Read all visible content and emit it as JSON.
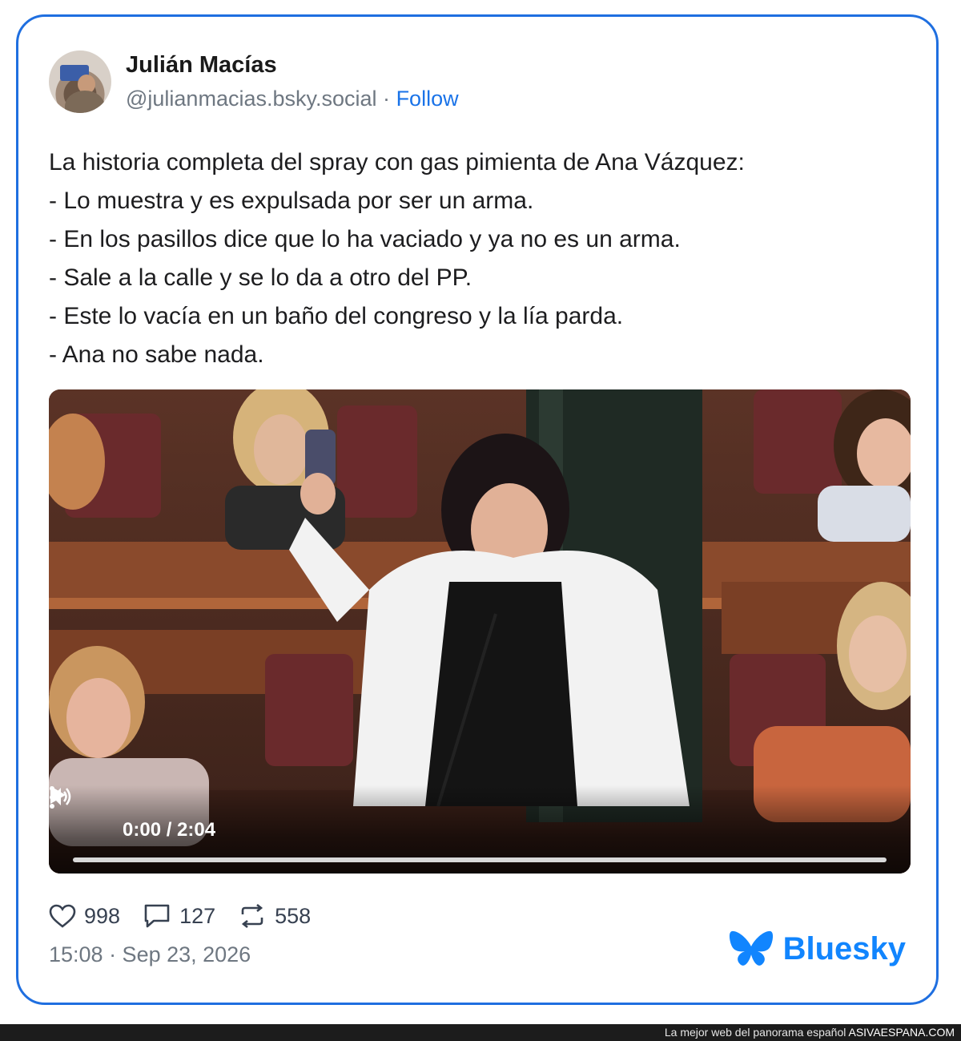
{
  "post": {
    "author_name": "Julián Macías",
    "handle": "@julianmacias.bsky.social",
    "separator": "·",
    "follow_label": "Follow",
    "text_lines": [
      "La historia completa del spray con gas pimienta de Ana Vázquez:",
      "- Lo muestra y es expulsada por ser un arma.",
      "- En los pasillos dice que lo ha vaciado y ya no es un arma.",
      "- Sale a la calle y se lo da a otro del PP.",
      "- Este lo vacía en un baño del congreso y la lía parda.",
      "- Ana no sabe nada."
    ],
    "video": {
      "time_label": "0:00 / 2:04",
      "progress": 0,
      "play_icon": "play-icon",
      "volume_icon": "volume-icon",
      "more_icon": "more-vertical-icon"
    },
    "stats": {
      "likes": "998",
      "replies": "127",
      "reposts": "558"
    },
    "timestamp": "15:08 · Sep 23, 2026",
    "brand_label": "Bluesky"
  },
  "footer": {
    "tagline": "La mejor web del panorama español",
    "site": "ASIVAESPANA.COM"
  },
  "colors": {
    "card_border": "#1f6fe0",
    "follow_link": "#1a73e8",
    "bluesky_blue": "#1185fe",
    "footer_bg": "#1c1c1c"
  }
}
